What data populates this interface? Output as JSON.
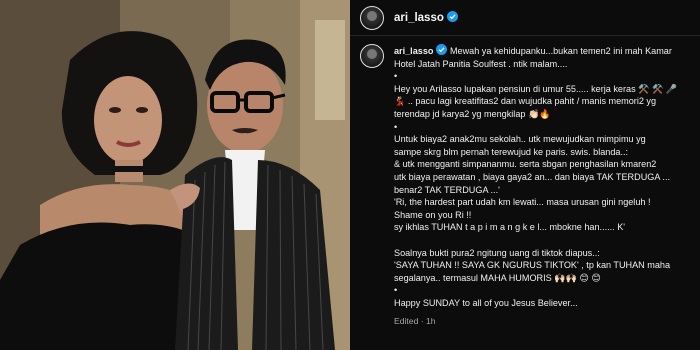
{
  "header": {
    "username": "ari_lasso",
    "verified": true
  },
  "post": {
    "username": "ari_lasso",
    "caption_lines": [
      "Mewah ya kehidupanku...bukan temen2 ini mah Kamar",
      "Hotel Jatah Panitia Soulfest . ntik malam....",
      "•",
      "Hey you Arilasso lupakan pensiun di umur 55..... kerja keras ⚒️ ⚒️ 🎤",
      "💃🏻 .. pacu lagi kreatifitas2 dan wujudka pahit / manis memori2 yg",
      "terendap jd karya2 yg mengkilap 👏🏻🔥",
      "•",
      "Untuk biaya2 anak2mu sekolah.. utk mewujudkan mimpimu yg",
      "sampe skrg blm pernah terewujud ke paris. swis. blanda..:",
      "& utk mengganti simpananmu. serta sbgan penghasilan kmaren2",
      "utk biaya perawatan , biaya gaya2 an... dan biaya TAK TERDUGA ...",
      "benar2 TAK TERDUGA ...'",
      "'Ri, the hardest part udah km lewati... masa urusan gini ngeluh !",
      "Shame on you Ri !!",
      "sy ikhlas TUHAN t a p i m a n g k e l... mbokne han...... K'",
      "",
      "Soalnya bukti pura2 ngitung uang di tiktok diapus..:",
      "'SAYA TUHAN !! SAYA GK NGURUS TIKTOK' , tp kan TUHAN maha",
      "segalanya.. termasul MAHA HUMORIS 🙌🏻🙌🏻 😊 😊",
      "•",
      "Happy SUNDAY to all of you Jesus Believer..."
    ],
    "edited_label": "Edited",
    "time_label": "1h"
  },
  "colors": {
    "verified_blue": "#1d9bf0",
    "panel_bg": "#0c0c0c",
    "meta_text": "#a8a8a8"
  }
}
